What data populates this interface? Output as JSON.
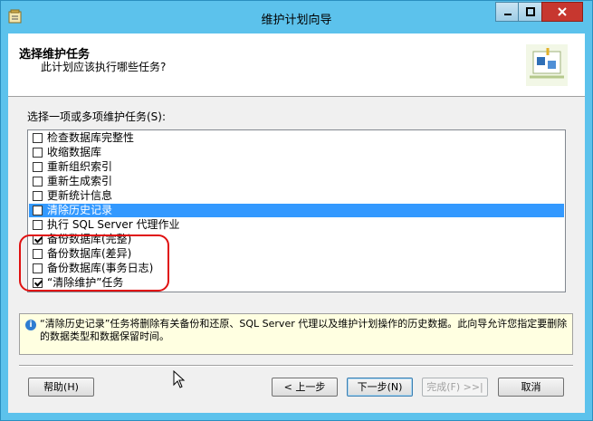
{
  "window": {
    "title": "维护计划向导"
  },
  "header": {
    "title": "选择维护任务",
    "subtitle": "此计划应该执行哪些任务?"
  },
  "instruction": "选择一项或多项维护任务(S):",
  "tasks": [
    {
      "label": "检查数据库完整性",
      "checked": false,
      "selected": false
    },
    {
      "label": "收缩数据库",
      "checked": false,
      "selected": false
    },
    {
      "label": "重新组织索引",
      "checked": false,
      "selected": false
    },
    {
      "label": "重新生成索引",
      "checked": false,
      "selected": false
    },
    {
      "label": "更新统计信息",
      "checked": false,
      "selected": false
    },
    {
      "label": "清除历史记录",
      "checked": false,
      "selected": true
    },
    {
      "label": "执行 SQL Server 代理作业",
      "checked": false,
      "selected": false
    },
    {
      "label": "备份数据库(完整)",
      "checked": true,
      "selected": false
    },
    {
      "label": "备份数据库(差异)",
      "checked": false,
      "selected": false
    },
    {
      "label": "备份数据库(事务日志)",
      "checked": false,
      "selected": false
    },
    {
      "label": "“清除维护”任务",
      "checked": true,
      "selected": false
    }
  ],
  "description": "“清除历史记录”任务将删除有关备份和还原、SQL Server 代理以及维护计划操作的历史数据。此向导允许您指定要删除的数据类型和数据保留时间。",
  "buttons": {
    "help": "帮助(H)",
    "back": "< 上一步",
    "next": "下一步(N)",
    "finish": "完成(F) >>|",
    "cancel": "取消"
  },
  "colors": {
    "selection": "#3399ff",
    "annotation": "#e01010",
    "titlebar": "#5cc2ec"
  }
}
